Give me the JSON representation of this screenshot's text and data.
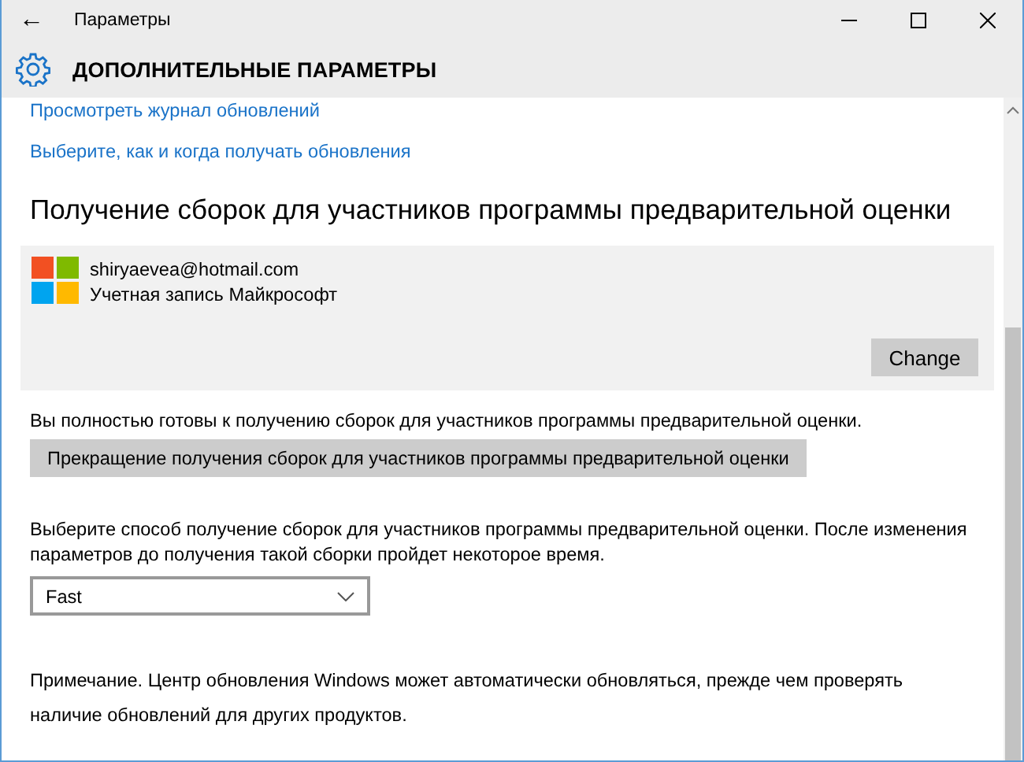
{
  "window": {
    "title": "Параметры",
    "back": "←"
  },
  "header": {
    "title": "ДОПОЛНИТЕЛЬНЫЕ ПАРАМЕТРЫ"
  },
  "links": [
    "Просмотреть журнал обновлений",
    "Выберите, как и когда получать обновления"
  ],
  "section": {
    "heading": "Получение сборок для участников программы предварительной оценки"
  },
  "account": {
    "email": "shiryaevea@hotmail.com",
    "type": "Учетная запись Майкрософт",
    "button": "Change"
  },
  "status": "Вы полностью готовы к получению сборок для участников программы предварительной оценки.",
  "stop_button": "Прекращение получения сборок для участников программы предварительной оценки",
  "choose_text": "Выберите способ получение сборок для участников программы предварительной оценки. После изменения параметров до получения такой сборки пройдет некоторое время.",
  "dropdown": {
    "value": "Fast"
  },
  "note": "Примечание. Центр обновления Windows может автоматически обновляться, прежде чем проверять наличие обновлений для других продуктов."
}
